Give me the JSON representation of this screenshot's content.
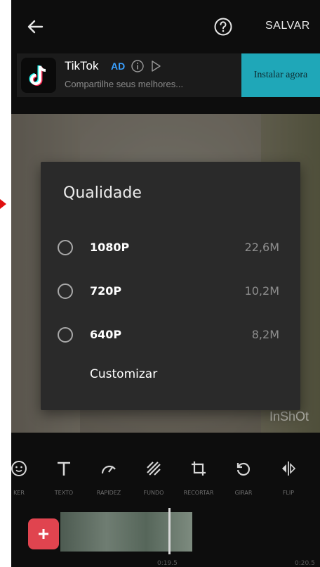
{
  "header": {
    "save_label": "SALVAR"
  },
  "ad": {
    "title": "TikTok",
    "badge": "AD",
    "subtitle": "Compartilhe seus melhores...",
    "install_label": "Instalar agora"
  },
  "dialog": {
    "title": "Qualidade",
    "options": [
      {
        "label": "1080P",
        "size": "22,6M"
      },
      {
        "label": "720P",
        "size": "10,2M"
      },
      {
        "label": "640P",
        "size": "8,2M"
      }
    ],
    "customize_label": "Customizar"
  },
  "preview": {
    "watermark": "InShOt"
  },
  "toolbar": {
    "items": [
      {
        "label": "KER",
        "icon": "sticker-icon"
      },
      {
        "label": "TEXTO",
        "icon": "text-icon"
      },
      {
        "label": "RAPIDEZ",
        "icon": "speed-icon"
      },
      {
        "label": "FUNDO",
        "icon": "background-icon"
      },
      {
        "label": "RECORTAR",
        "icon": "crop-icon"
      },
      {
        "label": "GIRAR",
        "icon": "rotate-icon"
      },
      {
        "label": "FLIP",
        "icon": "flip-icon"
      }
    ]
  },
  "timeline": {
    "time_current": "0:19.5",
    "time_total": "0:20.5"
  },
  "colors": {
    "accent_add": "#e0444f",
    "ad_install": "#1fa7b8",
    "dialog_bg": "#2a2a2a"
  }
}
